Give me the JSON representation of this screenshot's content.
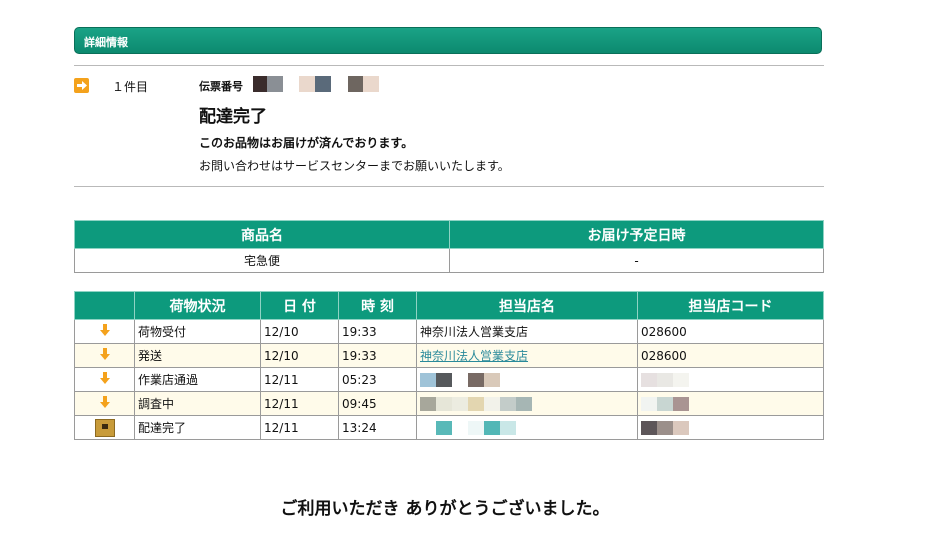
{
  "header": {
    "title": "詳細情報"
  },
  "item": {
    "number": "１件目",
    "slip_label": "伝票番号",
    "status_title": "配達完了",
    "status_message": "このお品物はお届けが済んでおります。",
    "inquiry_message": "お問い合わせはサービスセンターまでお願いいたします。"
  },
  "product_table": {
    "headers": [
      "商品名",
      "お届け予定日時"
    ],
    "row": [
      "宅急便",
      "-"
    ]
  },
  "tracking_table": {
    "headers": [
      "",
      "荷物状況",
      "日 付",
      "時 刻",
      "担当店名",
      "担当店コード"
    ],
    "rows": [
      {
        "icon": "down-arrow-icon",
        "status": "荷物受付",
        "date": "12/10",
        "time": "19:33",
        "store": "神奈川法人営業支店",
        "code": "028600"
      },
      {
        "icon": "down-arrow-icon",
        "status": "発送",
        "date": "12/10",
        "time": "19:33",
        "store": "神奈川法人営業支店",
        "code": "028600"
      },
      {
        "icon": "down-arrow-icon",
        "status": "作業店通過",
        "date": "12/11",
        "time": "05:23",
        "store": "",
        "code": ""
      },
      {
        "icon": "down-arrow-icon",
        "status": "調査中",
        "date": "12/11",
        "time": "09:45",
        "store": "",
        "code": ""
      },
      {
        "icon": "delivered-box-icon",
        "status": "配達完了",
        "date": "12/11",
        "time": "13:24",
        "store": "",
        "code": ""
      }
    ]
  },
  "footer": {
    "thanks": "ご利用いただき ありがとうございました。"
  },
  "colors": {
    "accent": "#0d9a7d",
    "arrow": "#f4a21c",
    "link": "#2a8a9a"
  }
}
